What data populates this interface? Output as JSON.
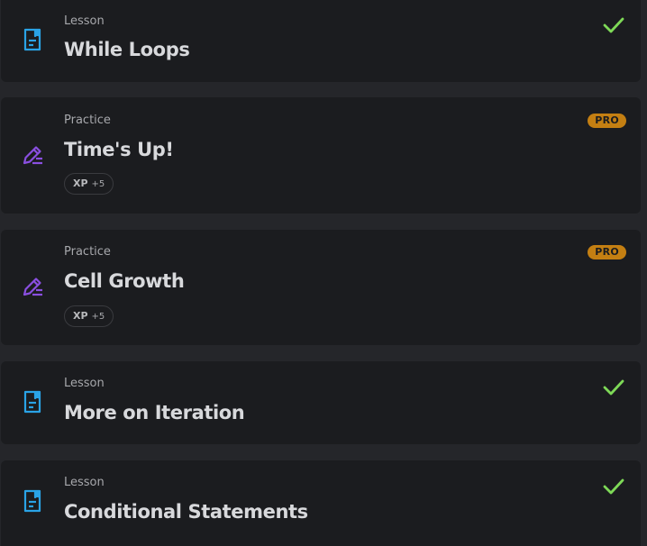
{
  "colors": {
    "background": "#25262a",
    "card": "#1b1c1f",
    "lesson_icon": "#2aa3e6",
    "practice_icon": "#8a4fe0",
    "check": "#7ed957",
    "pro_badge": "#c47f12"
  },
  "items": [
    {
      "kind": "Lesson",
      "title": "While Loops",
      "icon": "lesson-document-icon",
      "status": "check-icon"
    },
    {
      "kind": "Practice",
      "title": "Time's Up!",
      "icon": "pencil-practice-icon",
      "badge": "PRO",
      "xp_label": "XP",
      "xp_value": "+5"
    },
    {
      "kind": "Practice",
      "title": "Cell Growth",
      "icon": "pencil-practice-icon",
      "badge": "PRO",
      "xp_label": "XP",
      "xp_value": "+5"
    },
    {
      "kind": "Lesson",
      "title": "More on Iteration",
      "icon": "lesson-document-icon",
      "status": "check-icon"
    },
    {
      "kind": "Lesson",
      "title": "Conditional Statements",
      "icon": "lesson-document-icon",
      "status": "check-icon"
    }
  ]
}
